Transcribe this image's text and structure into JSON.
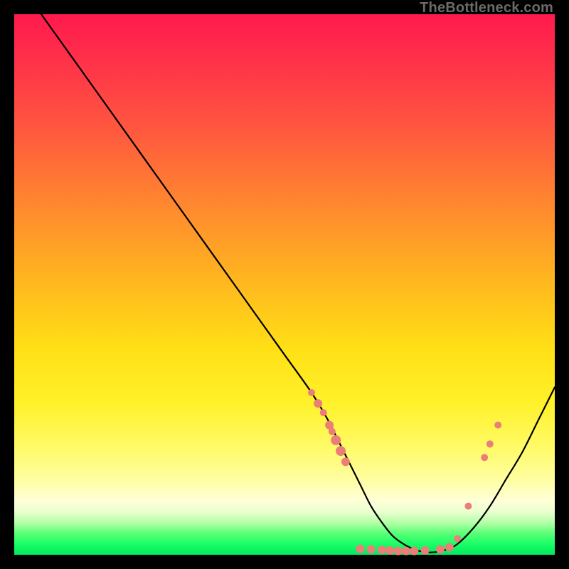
{
  "watermark": "TheBottleneck.com",
  "colors": {
    "curve_stroke": "#000000",
    "marker_fill": "#ec7e78",
    "marker_stroke": "#d9564f"
  },
  "chart_data": {
    "type": "line",
    "title": "",
    "xlabel": "",
    "ylabel": "",
    "xlim": [
      0,
      100
    ],
    "ylim": [
      0,
      100
    ],
    "grid": false,
    "legend": false,
    "series": [
      {
        "name": "bottleneck-curve",
        "x": [
          5,
          10,
          15,
          20,
          25,
          30,
          35,
          40,
          45,
          50,
          55,
          58,
          60,
          62,
          64,
          66,
          68,
          70,
          72,
          74,
          76,
          78,
          80,
          82,
          85,
          88,
          91,
          94,
          97,
          100
        ],
        "y": [
          100,
          93,
          86,
          79,
          72,
          65,
          58,
          51,
          44,
          37,
          30,
          25,
          21,
          17,
          13,
          9,
          6,
          3.5,
          2,
          1,
          0.5,
          0.5,
          1,
          2,
          5,
          9,
          14,
          19,
          25,
          31
        ]
      }
    ],
    "markers": [
      {
        "x": 55.0,
        "y": 30.0,
        "r": 5
      },
      {
        "x": 56.2,
        "y": 28.0,
        "r": 6
      },
      {
        "x": 57.2,
        "y": 26.3,
        "r": 5
      },
      {
        "x": 58.3,
        "y": 24.0,
        "r": 6
      },
      {
        "x": 58.8,
        "y": 22.8,
        "r": 5
      },
      {
        "x": 59.5,
        "y": 21.2,
        "r": 7
      },
      {
        "x": 60.4,
        "y": 19.2,
        "r": 7
      },
      {
        "x": 61.3,
        "y": 17.2,
        "r": 6
      },
      {
        "x": 64.0,
        "y": 1.1,
        "r": 6
      },
      {
        "x": 66.0,
        "y": 1.0,
        "r": 6
      },
      {
        "x": 68.0,
        "y": 0.9,
        "r": 6
      },
      {
        "x": 69.5,
        "y": 0.8,
        "r": 6
      },
      {
        "x": 71.0,
        "y": 0.7,
        "r": 6
      },
      {
        "x": 72.5,
        "y": 0.7,
        "r": 6
      },
      {
        "x": 74.0,
        "y": 0.7,
        "r": 6
      },
      {
        "x": 76.0,
        "y": 0.8,
        "r": 6
      },
      {
        "x": 78.8,
        "y": 1.0,
        "r": 6
      },
      {
        "x": 80.5,
        "y": 1.4,
        "r": 6
      },
      {
        "x": 82.0,
        "y": 3.0,
        "r": 5
      },
      {
        "x": 84.0,
        "y": 9.0,
        "r": 5
      },
      {
        "x": 87.0,
        "y": 18.0,
        "r": 5
      },
      {
        "x": 88.0,
        "y": 20.5,
        "r": 5
      },
      {
        "x": 89.5,
        "y": 24.0,
        "r": 5
      }
    ]
  }
}
